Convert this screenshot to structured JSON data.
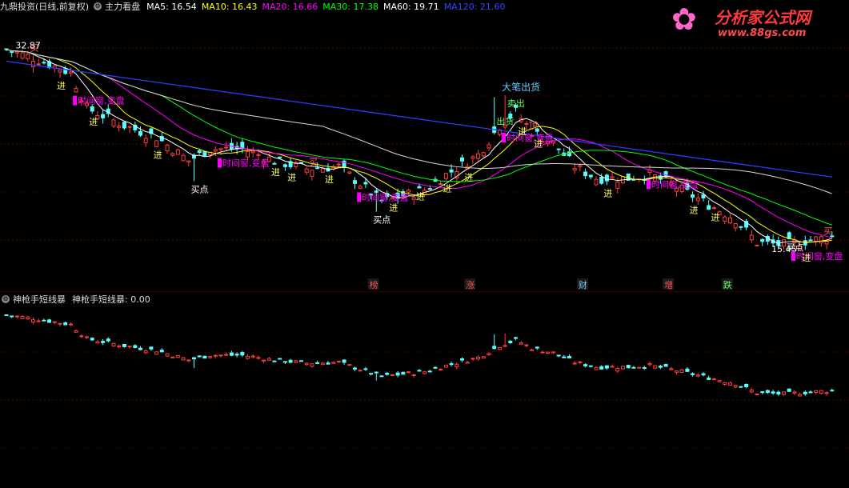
{
  "window": {
    "title": "九鼎投资(日线,前复权)",
    "indicator_name": "主力看盘"
  },
  "ma_legend": [
    {
      "label": "MA5: 16.54",
      "color": "#ffffff"
    },
    {
      "label": "MA10: 16.43",
      "color": "#ffff00"
    },
    {
      "label": "MA20: 16.66",
      "color": "#ff00ff"
    },
    {
      "label": "MA30: 17.38",
      "color": "#00ff00"
    },
    {
      "label": "MA60: 19.71",
      "color": "#ffffff"
    },
    {
      "label": "MA120: 21.60",
      "color": "#0000ff"
    }
  ],
  "lower_panel": {
    "title": "神枪手短线暴",
    "label": "神枪手短线暴: 0.00"
  },
  "logo": {
    "name": "分析家公式网",
    "url": "www.88gs.com"
  },
  "chart_data": {
    "type": "candlestick",
    "price_labels": [
      {
        "text": "32.87",
        "price": 32.87,
        "bar": 2
      },
      {
        "text": "15.45",
        "price": 15.45,
        "bar": 143
      }
    ],
    "annotations": [
      {
        "text": "大笔出货",
        "bar": 93,
        "color": "#66ccff"
      },
      {
        "text": "买点",
        "bar": 35,
        "color": "#ffffff"
      },
      {
        "text": "买点",
        "bar": 69,
        "color": "#ffffff"
      },
      {
        "text": "买点",
        "bar": 146,
        "color": "#ffffff"
      },
      {
        "text": "时间窗,变盘",
        "bar": 13,
        "color": "#ff00ff"
      },
      {
        "text": "时间窗,变盘",
        "bar": 40,
        "color": "#ff00ff"
      },
      {
        "text": "时间窗,变盘",
        "bar": 66,
        "color": "#ff00ff"
      },
      {
        "text": "时间窗,变盘",
        "bar": 93,
        "color": "#ff00ff"
      },
      {
        "text": "时间窗,变盘",
        "bar": 120,
        "color": "#ff00ff"
      },
      {
        "text": "时间窗,变盘",
        "bar": 147,
        "color": "#ff00ff"
      },
      {
        "text": "进",
        "bar": 10,
        "color": "#ffff66"
      },
      {
        "text": "进",
        "bar": 16,
        "color": "#ffff66"
      },
      {
        "text": "进",
        "bar": 28,
        "color": "#ffff66"
      },
      {
        "text": "进",
        "bar": 50,
        "color": "#ffff66"
      },
      {
        "text": "进",
        "bar": 53,
        "color": "#ffff66"
      },
      {
        "text": "进",
        "bar": 60,
        "color": "#ffff66"
      },
      {
        "text": "进",
        "bar": 72,
        "color": "#ffff66"
      },
      {
        "text": "进",
        "bar": 77,
        "color": "#ffff66"
      },
      {
        "text": "进",
        "bar": 82,
        "color": "#ffff66"
      },
      {
        "text": "进",
        "bar": 86,
        "color": "#ffff66"
      },
      {
        "text": "进",
        "bar": 96,
        "color": "#ffff66"
      },
      {
        "text": "进",
        "bar": 99,
        "color": "#ffff66"
      },
      {
        "text": "进",
        "bar": 112,
        "color": "#ffff66"
      },
      {
        "text": "进",
        "bar": 128,
        "color": "#ffff66"
      },
      {
        "text": "进",
        "bar": 132,
        "color": "#ffff66"
      },
      {
        "text": "进",
        "bar": 149,
        "color": "#ffff66"
      },
      {
        "text": "出货",
        "bar": 92,
        "color": "#66ff66"
      },
      {
        "text": "卖出",
        "bar": 94,
        "color": "#66ff66"
      },
      {
        "text": "买",
        "bar": 5,
        "color": "#ff6666"
      },
      {
        "text": "买",
        "bar": 57,
        "color": "#ff6666"
      },
      {
        "text": "买",
        "bar": 153,
        "color": "#ff6666"
      },
      {
        "text": "顶",
        "bar": 98,
        "color": "#ff6666"
      }
    ],
    "bottom_markers": [
      {
        "text": "榜",
        "bar": 68,
        "color": "#ff5050"
      },
      {
        "text": "涨",
        "bar": 86,
        "color": "#ff5050"
      },
      {
        "text": "财",
        "bar": 107,
        "color": "#66ccff"
      },
      {
        "text": "增",
        "bar": 123,
        "color": "#ff5050"
      },
      {
        "text": "跌",
        "bar": 134,
        "color": "#66ff66"
      }
    ],
    "lower_value": 0.0
  }
}
